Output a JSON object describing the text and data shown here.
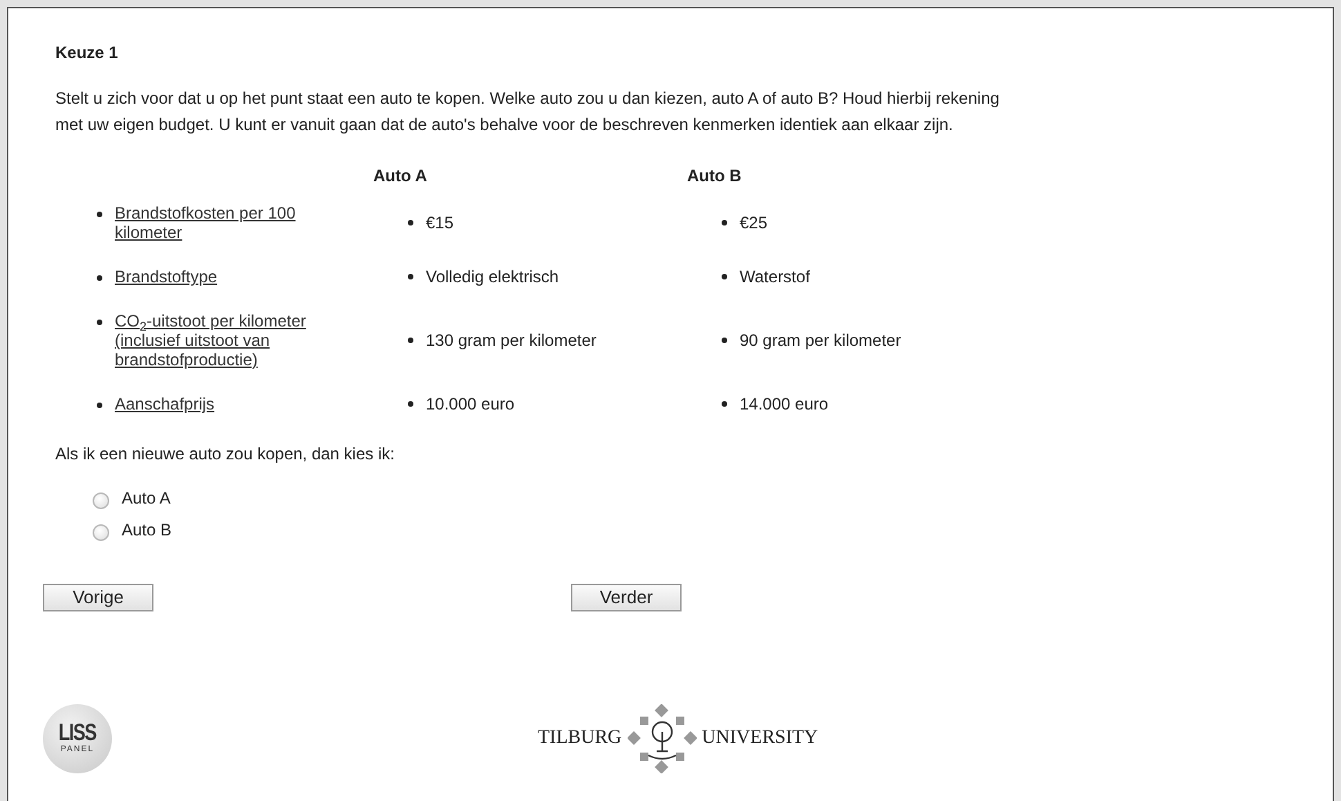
{
  "heading": "Keuze 1",
  "intro": "Stelt u zich voor dat u op het punt staat een auto te kopen. Welke auto zou u dan kiezen, auto A of auto B? Houd hierbij rekening met uw eigen budget. U kunt er vanuit gaan dat de auto's behalve voor de beschreven kenmerken identiek aan elkaar zijn.",
  "table": {
    "columns": [
      "Auto A",
      "Auto B"
    ],
    "rows": [
      {
        "attribute": "Brandstofkosten per 100 kilometer",
        "values": [
          "€15",
          "€25"
        ]
      },
      {
        "attribute": "Brandstoftype",
        "values": [
          "Volledig elektrisch",
          "Waterstof"
        ]
      },
      {
        "attribute": "CO$_{2}$-uitstoot per kilometer (inclusief uitstoot van brandstofproductie)",
        "values": [
          "130 gram per kilometer",
          "90 gram per kilometer"
        ]
      },
      {
        "attribute": "Aanschafprijs",
        "values": [
          "10.000 euro",
          "14.000 euro"
        ]
      }
    ]
  },
  "question": "Als ik een nieuwe auto zou kopen, dan kies ik:",
  "options": [
    {
      "label": "Auto A",
      "selected": false
    },
    {
      "label": "Auto B",
      "selected": false
    }
  ],
  "buttons": [
    {
      "label": "Vorige"
    },
    {
      "label": "Verder"
    }
  ],
  "footer": {
    "left_logo": {
      "text": "LISS",
      "subtext": "PANEL"
    },
    "right_logo": {
      "left": "TILBURG",
      "right": "UNIVERSITY"
    }
  }
}
